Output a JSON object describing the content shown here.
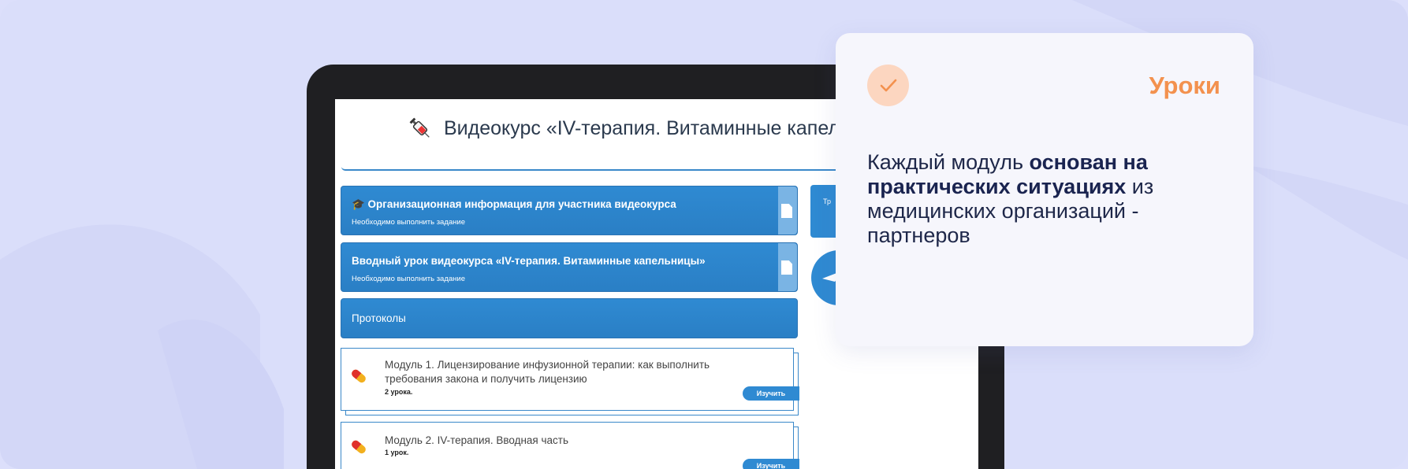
{
  "course": {
    "title": "Видеокурс «IV-терапия. Витаминные капельницы»"
  },
  "cards": [
    {
      "title": "🎓 Организационная информация для участника видеокурса",
      "subtitle": "Необходимо выполнить задание"
    },
    {
      "title": "Вводный урок видеокурса «IV-терапия. Витаминные капельницы»",
      "subtitle": "Необходимо выполнить задание"
    },
    {
      "title": "Протоколы"
    }
  ],
  "right_widget": {
    "label": "Тр"
  },
  "modules": [
    {
      "title": "Модуль 1. Лицензирование инфузионной терапии: как выполнить требования закона и получить лицензию",
      "count": "2 урока.",
      "button": "Изучить"
    },
    {
      "title": "Модуль 2. IV-терапия. Вводная часть",
      "count": "1 урок.",
      "button": "Изучить"
    }
  ],
  "info": {
    "badge": "Уроки",
    "text_part1": "Каждый модуль ",
    "text_bold": "основан на практических ситуациях",
    "text_part2": " из медицинских организаций - партнеров"
  },
  "colors": {
    "accent_blue": "#2f8ad2",
    "orange": "#f3914e",
    "background": "#dadefa"
  },
  "icons": [
    "syringe-icon",
    "graduation-cap-icon",
    "document-icon",
    "pill-icon",
    "check-icon",
    "telegram-icon"
  ]
}
